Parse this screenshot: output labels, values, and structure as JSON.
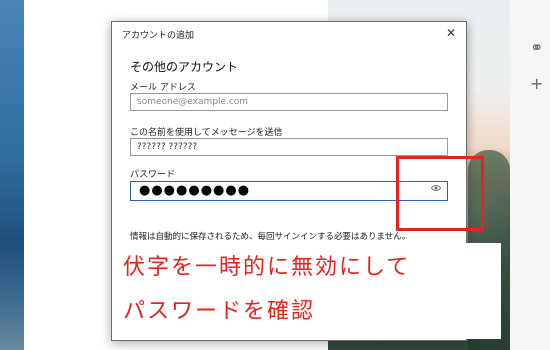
{
  "dialog": {
    "title": "アカウントの追加",
    "close_glyph": "✕",
    "heading": "その他のアカウント",
    "email": {
      "label": "メール アドレス",
      "placeholder": "someone@example.com"
    },
    "name": {
      "label": "この名前を使用してメッセージを送信",
      "value": "?????? ??????"
    },
    "password": {
      "label": "パスワード",
      "value_masked": "●●●●●●●●●",
      "reveal_icon": "eye-icon"
    },
    "note": "情報は自動的に保存されるため、毎回サインインする必要はありません。"
  },
  "side_panel": {
    "icons": [
      "link-icon",
      "plus-icon"
    ],
    "link_glyph": "⚭",
    "plus_glyph": "+"
  },
  "annotation": {
    "caption_line1": "伏字を一時的に無効にして",
    "caption_line2": "パスワードを確認",
    "color": "#e8221f"
  }
}
